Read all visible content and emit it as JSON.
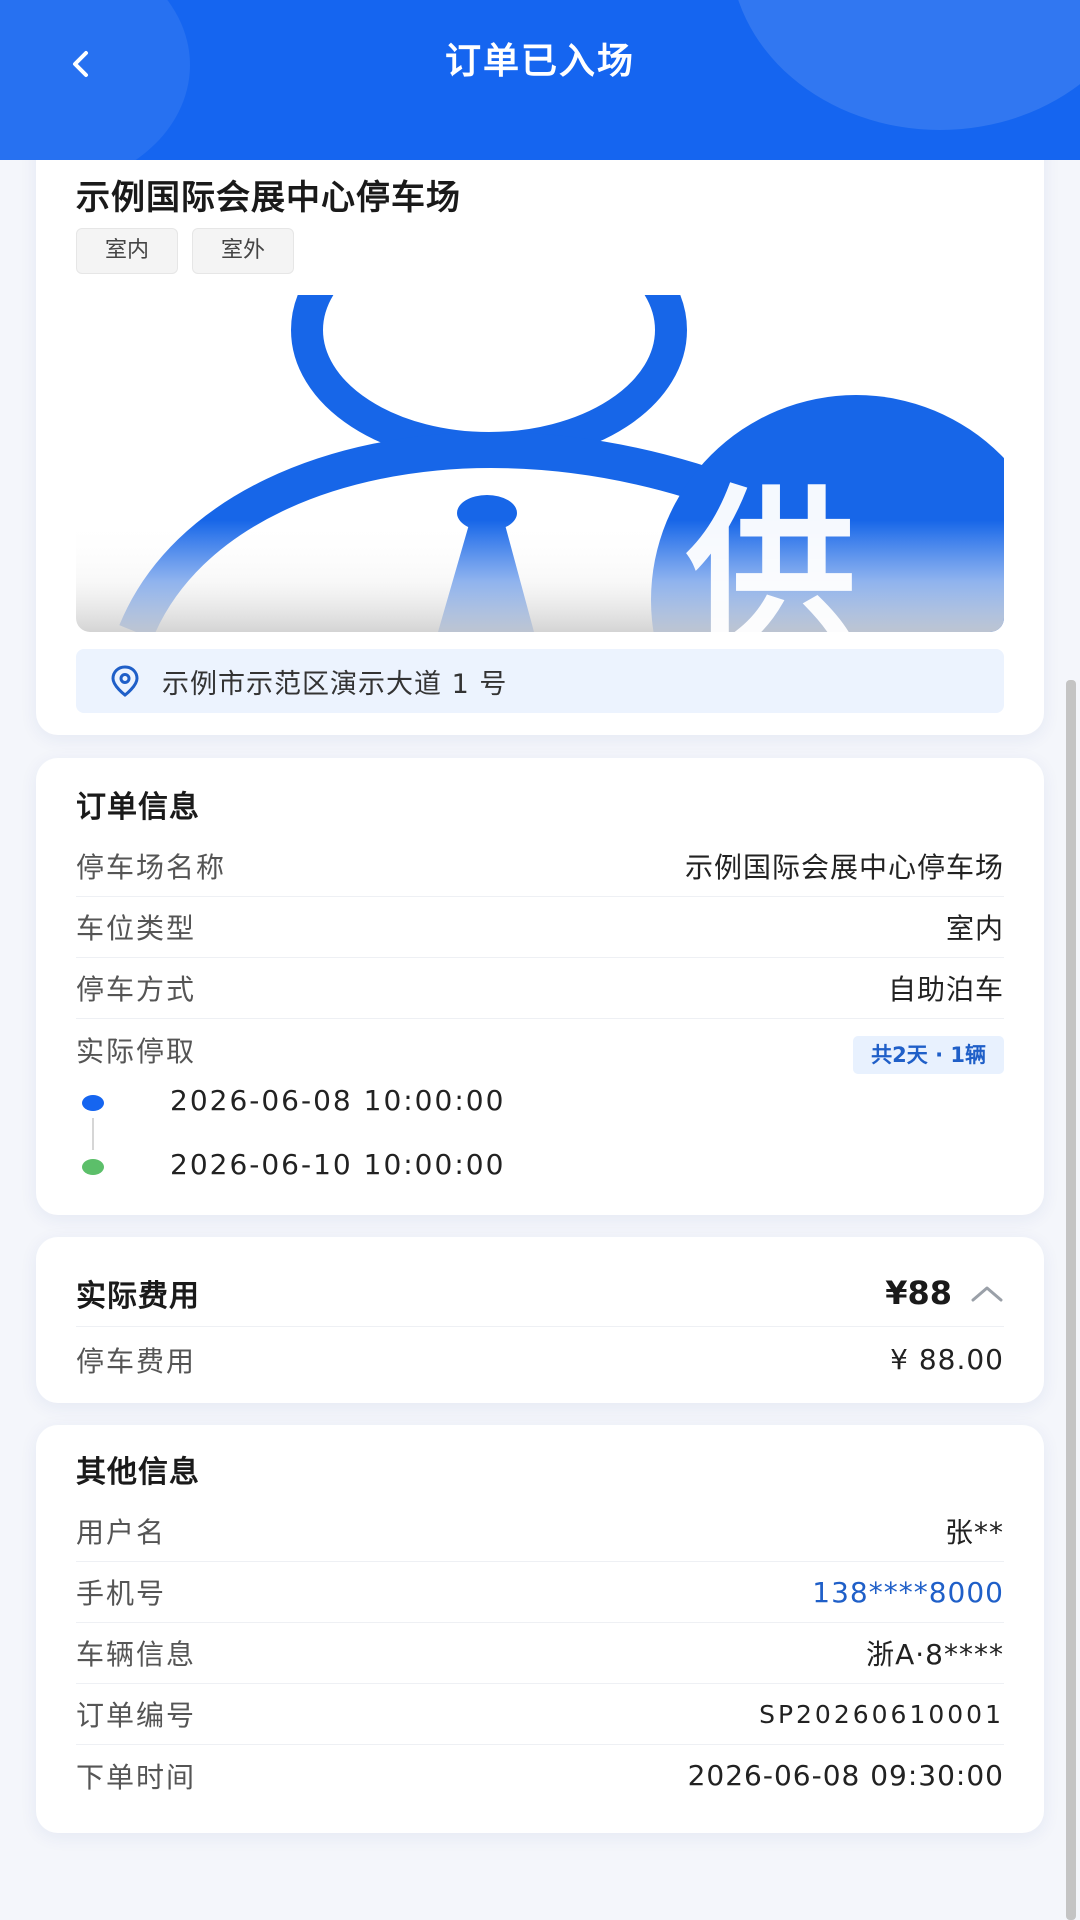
{
  "header": {
    "title": "订单已入场"
  },
  "lot": {
    "name": "示例国际会展中心停车场",
    "tags": [
      "室内",
      "室外"
    ],
    "image_text": "供",
    "address": "示例市示范区演示大道 1 号"
  },
  "order_info": {
    "title": "订单信息",
    "rows": [
      {
        "label": "停车场名称",
        "value": "示例国际会展中心停车场"
      },
      {
        "label": "车位类型",
        "value": "室内"
      },
      {
        "label": "停车方式",
        "value": "自助泊车"
      }
    ],
    "actual_label": "实际停取",
    "duration_badge": "共2天 · 1辆",
    "start_time": "2026-06-08 10:00:00",
    "end_time": "2026-06-10 10:00:00"
  },
  "fee": {
    "title": "实际费用",
    "total": "¥88",
    "rows": [
      {
        "label": "停车费用",
        "value": "¥ 88.00"
      }
    ]
  },
  "other_info": {
    "title": "其他信息",
    "rows": [
      {
        "label": "用户名",
        "value": "张**"
      },
      {
        "label": "手机号",
        "value": "138****8000"
      },
      {
        "label": "车辆信息",
        "value": "浙A·8****"
      },
      {
        "label": "订单编号",
        "value": "SP20260610001"
      },
      {
        "label": "下单时间",
        "value": "2026-06-08 09:30:00"
      }
    ]
  },
  "icons": {
    "back": "chevron-left-icon",
    "location": "location-pin-icon",
    "collapse": "chevron-up-icon"
  },
  "colors": {
    "brand_blue": "#1565f0",
    "link_blue": "#1f5fc8",
    "start_dot": "#1565f0",
    "end_dot": "#5cbf6a",
    "page_background": "#f4f6fb"
  }
}
